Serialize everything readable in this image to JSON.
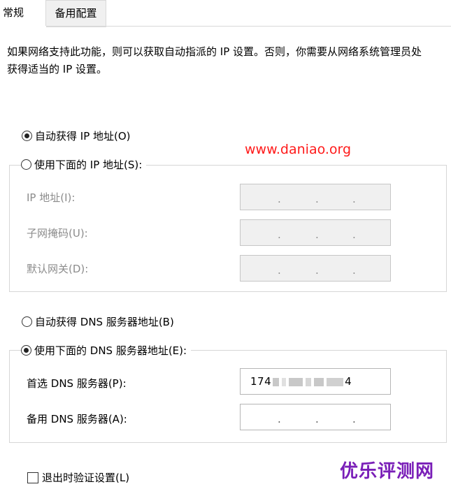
{
  "tabs": {
    "general": "常规",
    "alternate": "备用配置"
  },
  "description": "如果网络支持此功能，则可以获取自动指派的 IP 设置。否则，你需要从网络系统管理员处获得适当的 IP 设置。",
  "ip": {
    "auto_label": "自动获得 IP 地址(O)",
    "manual_label": "使用下面的 IP 地址(S):",
    "address_label": "IP 地址(I):",
    "subnet_label": "子网掩码(U):",
    "gateway_label": "默认网关(D):",
    "dot": "."
  },
  "dns": {
    "auto_label": "自动获得 DNS 服务器地址(B)",
    "manual_label": "使用下面的 DNS 服务器地址(E):",
    "preferred_label": "首选 DNS 服务器(P):",
    "preferred_prefix": "174",
    "preferred_suffix": "4",
    "alternate_label": "备用 DNS 服务器(A):"
  },
  "validate_label": "退出时验证设置(L)",
  "watermark": "www.daniao.org",
  "brand": "优乐评测网",
  "colors": {
    "watermark": "#ff1a1a",
    "brand": "#7a1fb8"
  }
}
